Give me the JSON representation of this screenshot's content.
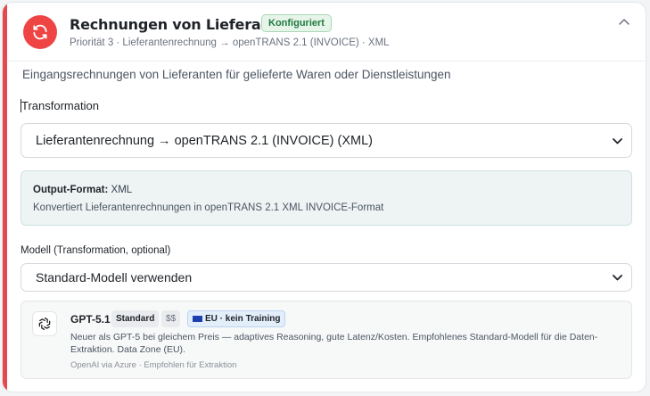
{
  "header": {
    "title": "Rechnungen von Lieferanten",
    "badge": "Konfiguriert",
    "subtitle": "Priorität 3 · Lieferantenrechnung → openTRANS 2.1 (INVOICE) · XML",
    "icon": "refresh-icon",
    "accent_color": "#ef4444"
  },
  "description": "Eingangsrechnungen von Lieferanten für gelieferte Waren oder Dienstleistungen",
  "transformation": {
    "label": "Transformation",
    "selected": "Lieferantenrechnung → openTRANS 2.1 (INVOICE) (XML)"
  },
  "output_info": {
    "format_label": "Output-Format:",
    "format_value": "XML",
    "details": "Konvertiert Lieferantenrechnungen in openTRANS 2.1 XML INVOICE-Format"
  },
  "model": {
    "label": "Modell (Transformation, optional)",
    "selected": "Standard-Modell verwenden",
    "card": {
      "name": "GPT-5.1",
      "tier": "Standard",
      "price": "$$",
      "region": "EU · kein Training",
      "description": "Neuer als GPT-5 bei gleichem Preis — adaptives Reasoning, gute Latenz/Kosten. Empfohlenes Standard-Modell für die Daten-Extraktion. Data Zone (EU).",
      "source": "OpenAI via Azure · Empfohlen für Extraktion",
      "logo": "openai-icon"
    }
  }
}
